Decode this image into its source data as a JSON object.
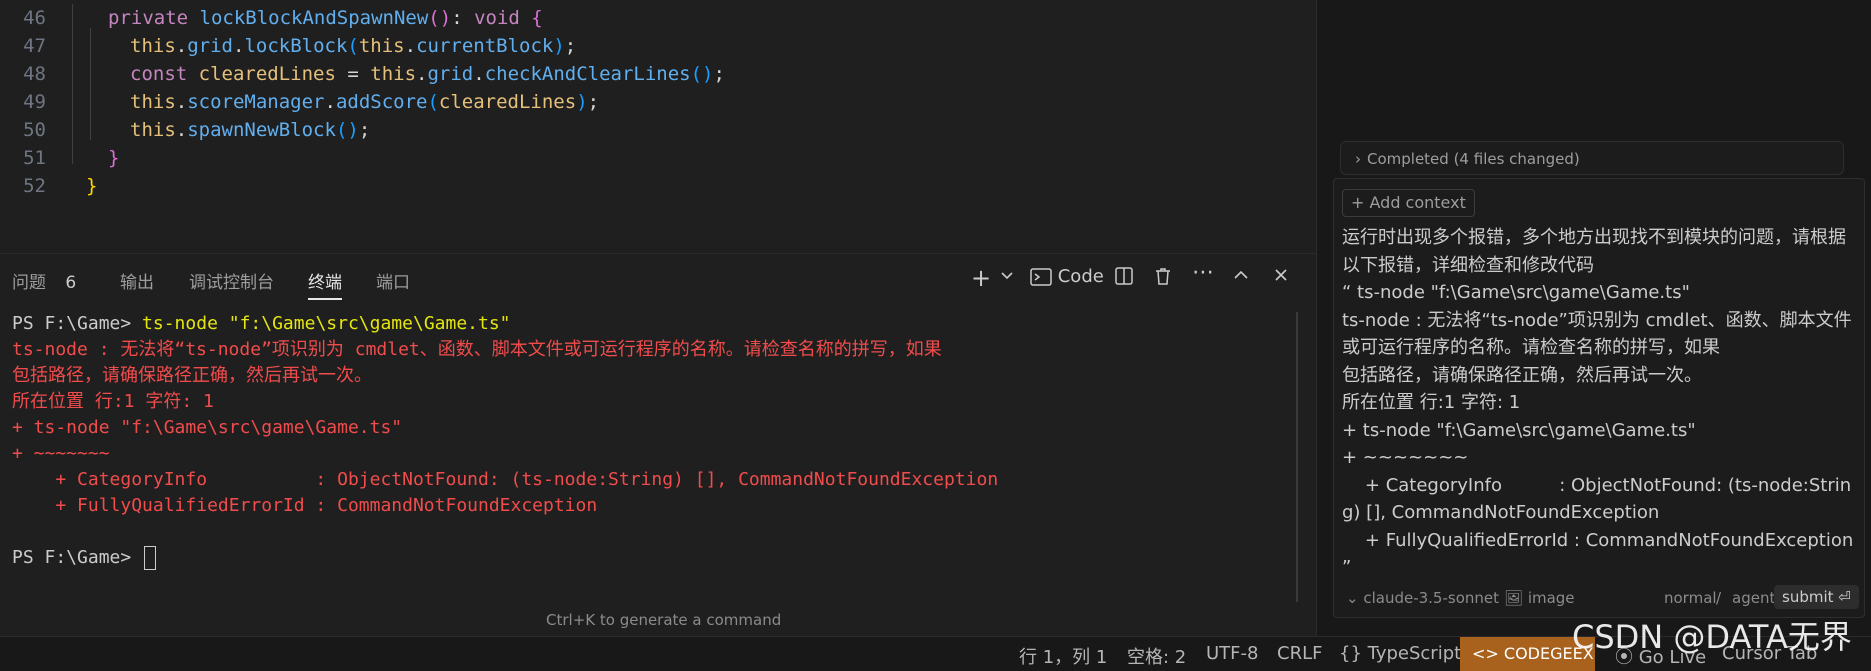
{
  "editor": {
    "lines": [
      {
        "num": "46",
        "tokens": [
          [
            "kw",
            "private "
          ],
          [
            "fn",
            "lockBlockAndSpawnNew"
          ],
          [
            "br2",
            "()"
          ],
          [
            "plain",
            ": "
          ],
          [
            "kw",
            "void "
          ],
          [
            "br2",
            "{"
          ]
        ]
      },
      {
        "num": "47",
        "tokens": [
          [
            "this",
            "this"
          ],
          [
            "plain",
            "."
          ],
          [
            "fn",
            "grid"
          ],
          [
            "plain",
            "."
          ],
          [
            "fn",
            "lockBlock"
          ],
          [
            "br3",
            "("
          ],
          [
            "this",
            "this"
          ],
          [
            "plain",
            "."
          ],
          [
            "fn",
            "currentBlock"
          ],
          [
            "br3",
            ")"
          ],
          [
            "plain",
            ";"
          ]
        ]
      },
      {
        "num": "48",
        "tokens": [
          [
            "kw",
            "const "
          ],
          [
            "var",
            "clearedLines"
          ],
          [
            "plain",
            " = "
          ],
          [
            "this",
            "this"
          ],
          [
            "plain",
            "."
          ],
          [
            "fn",
            "grid"
          ],
          [
            "plain",
            "."
          ],
          [
            "fn",
            "checkAndClearLines"
          ],
          [
            "br3",
            "()"
          ],
          [
            "plain",
            ";"
          ]
        ]
      },
      {
        "num": "49",
        "tokens": [
          [
            "this",
            "this"
          ],
          [
            "plain",
            "."
          ],
          [
            "fn",
            "scoreManager"
          ],
          [
            "plain",
            "."
          ],
          [
            "fn",
            "addScore"
          ],
          [
            "br3",
            "("
          ],
          [
            "var",
            "clearedLines"
          ],
          [
            "br3",
            ")"
          ],
          [
            "plain",
            ";"
          ]
        ]
      },
      {
        "num": "50",
        "tokens": [
          [
            "this",
            "this"
          ],
          [
            "plain",
            "."
          ],
          [
            "fn",
            "spawnNewBlock"
          ],
          [
            "br3",
            "()"
          ],
          [
            "plain",
            ";"
          ]
        ]
      },
      {
        "num": "51",
        "tokens": [
          [
            "br2",
            "}"
          ]
        ]
      },
      {
        "num": "52",
        "tokens": [
          [
            "br1",
            "}"
          ]
        ]
      }
    ]
  },
  "panel": {
    "tabs": [
      {
        "label": "问题",
        "badge": "6"
      },
      {
        "label": "输出"
      },
      {
        "label": "调试控制台"
      },
      {
        "label": "终端",
        "active": true
      },
      {
        "label": "端口"
      }
    ],
    "toolbar": {
      "add": "+",
      "launch_label": "Code"
    },
    "terminal": {
      "prompt1": "PS F:\\Game> ",
      "cmd1": "ts-node ",
      "arg1": "\"f:\\Game\\src\\game\\Game.ts\"",
      "error_lines": [
        "ts-node : 无法将“ts-node”项识别为 cmdlet、函数、脚本文件或可运行程序的名称。请检查名称的拼写，如果",
        "包括路径，请确保路径正确，然后再试一次。",
        "所在位置 行:1 字符: 1",
        "+ ts-node \"f:\\Game\\src\\game\\Game.ts\"",
        "+ ~~~~~~~",
        "    + CategoryInfo          : ObjectNotFound: (ts-node:String) [], CommandNotFoundException",
        "    + FullyQualifiedErrorId : CommandNotFoundException"
      ],
      "prompt2": "PS F:\\Game> "
    },
    "hint": "Ctrl+K to generate a command"
  },
  "chat": {
    "completed": "Completed (4 files changed)",
    "add_context": "+ Add context",
    "message": "运行时出现多个报错，多个地方出现找不到模块的问题，请根据以下报错，详细检查和修改代码\n“ ts-node \"f:\\Game\\src\\game\\Game.ts\"\nts-node : 无法将“ts-node”项识别为 cmdlet、函数、脚本文件或可运行程序的名称。请检查名称的拼写，如果\n包括路径，请确保路径正确，然后再试一次。\n所在位置 行:1 字符: 1\n+ ts-node \"f:\\Game\\src\\game\\Game.ts\"\n+ ~~~~~~~\n    + CategoryInfo          : ObjectNotFound: (ts-node:String) [], CommandNotFoundException\n    + FullyQualifiedErrorId : CommandNotFoundException\n”",
    "model": "claude-3.5-sonnet",
    "image_label": "image",
    "mode_normal": "normal",
    "mode_sep": "/",
    "mode_agent": "agent",
    "submit": "submit ⏎"
  },
  "status": {
    "position": "行 1，列 1",
    "spaces": "空格: 2",
    "encoding": "UTF-8",
    "eol": "CRLF",
    "language": "{} TypeScript",
    "codegeex": "<> CODEGEEX",
    "golive": "Go Live",
    "cursortab": "Cursor Tab"
  },
  "watermark": "CSDN @DATA无界",
  "colors": {
    "codegeex_bg": "#a8621e",
    "error": "#f14c4c",
    "cmd": "#e5e510"
  }
}
